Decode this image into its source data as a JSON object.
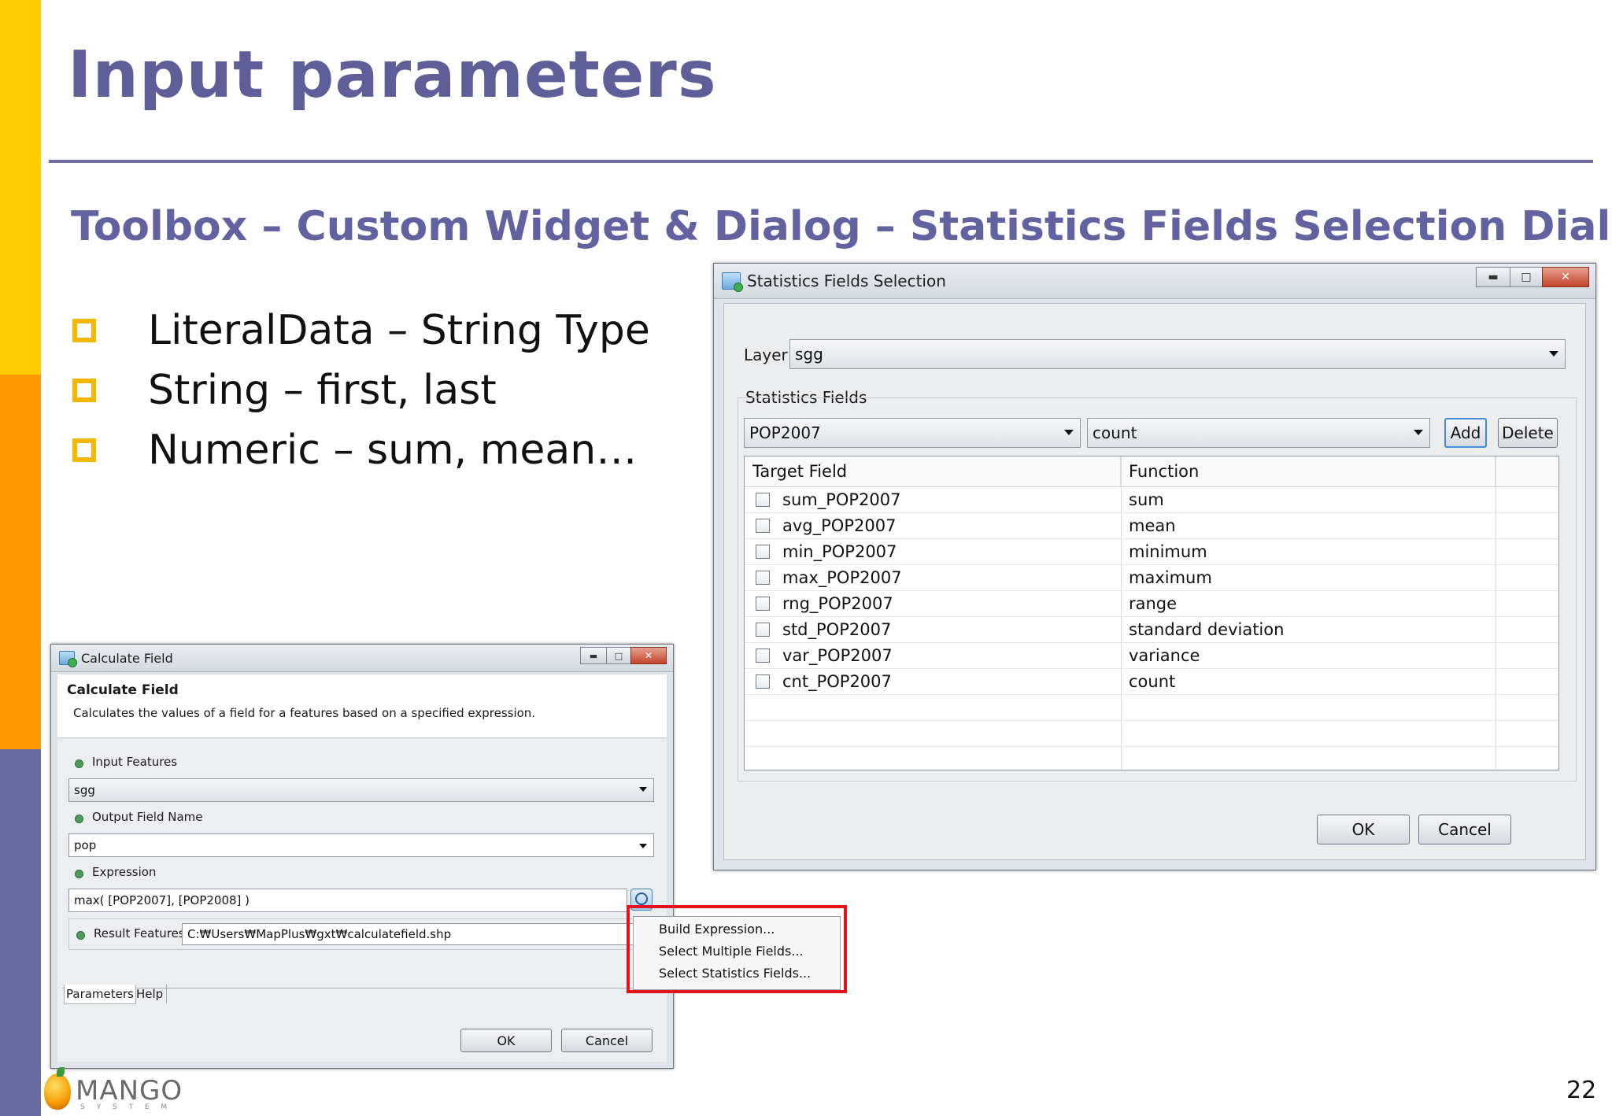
{
  "slide": {
    "title": "Input parameters",
    "subtitle": "Toolbox – Custom Widget & Dialog – Statistics Fields Selection Dialog",
    "bullets": [
      "LiteralData – String Type",
      "String – first, last",
      "Numeric – sum, mean…"
    ],
    "page_number": "22",
    "logo": {
      "name": "MANGO",
      "tagline": "S Y S T E M"
    },
    "colors": {
      "accent_yellow": "#ffcc00",
      "accent_orange": "#ff9900",
      "accent_purple": "#6b6ba4",
      "title": "#5e5e98"
    }
  },
  "stats_dialog": {
    "title": "Statistics Fields Selection",
    "layer_label": "Layer",
    "layer_value": "sgg",
    "group_label": "Statistics Fields",
    "field_value": "POP2007",
    "function_value": "count",
    "add_label": "Add",
    "delete_label": "Delete",
    "columns": [
      "Target Field",
      "Function"
    ],
    "rows": [
      {
        "target": "sum_POP2007",
        "function": "sum"
      },
      {
        "target": "avg_POP2007",
        "function": "mean"
      },
      {
        "target": "min_POP2007",
        "function": "minimum"
      },
      {
        "target": "max_POP2007",
        "function": "maximum"
      },
      {
        "target": "rng_POP2007",
        "function": "range"
      },
      {
        "target": "std_POP2007",
        "function": "standard deviation"
      },
      {
        "target": "var_POP2007",
        "function": "variance"
      },
      {
        "target": "cnt_POP2007",
        "function": "count"
      }
    ],
    "ok_label": "OK",
    "cancel_label": "Cancel"
  },
  "calc_dialog": {
    "title": "Calculate Field",
    "header_title": "Calculate Field",
    "header_desc": "Calculates the values of a field for a features based on a specified expression.",
    "input_label": "Input Features",
    "input_value": "sgg",
    "output_label": "Output Field Name",
    "output_value": "pop",
    "expression_label": "Expression",
    "expression_value": "max( [POP2007], [POP2008] )",
    "result_label": "Result Features",
    "result_value": "C:₩Users₩MapPlus₩gxt₩calculatefield.shp",
    "tabs": [
      "Parameters",
      "Help"
    ],
    "ok_label": "OK",
    "cancel_label": "Cancel"
  },
  "context_menu": {
    "items": [
      "Build Expression...",
      "Select Multiple Fields...",
      "Select Statistics Fields..."
    ]
  }
}
